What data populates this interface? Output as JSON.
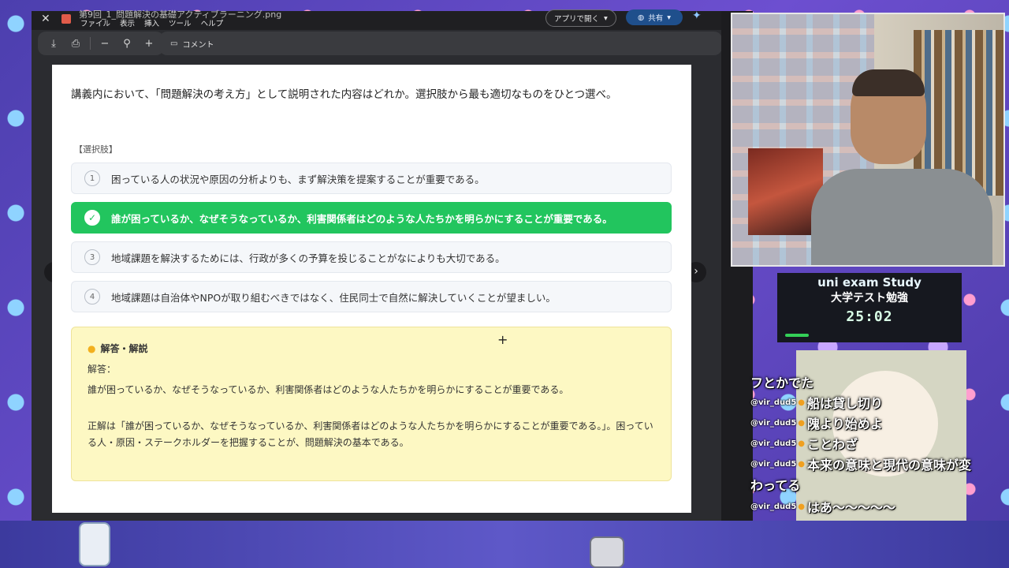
{
  "viewer": {
    "title": "第9回_1_問題解決の基礎アクティブラーニング.png",
    "menu": [
      "ファイル",
      "表示",
      "挿入",
      "ツール",
      "ヘルプ"
    ],
    "open_with_label": "アプリで開く",
    "share_label": "共有",
    "comment_label": "コメント"
  },
  "doc": {
    "question": "講義内において、「問題解決の考え方」として説明された内容はどれか。選択肢から最も適切なものをひとつ選べ。",
    "options_label": "【選択肢】",
    "options": [
      {
        "num": "1",
        "text": "困っている人の状況や原因の分析よりも、まず解決策を提案することが重要である。"
      },
      {
        "num": "✓",
        "text": "誰が困っているか、なぜそうなっているか、利害関係者はどのような人たちかを明らかにすることが重要である。"
      },
      {
        "num": "3",
        "text": "地域課題を解決するためには、行政が多くの予算を投じることがなによりも大切である。"
      },
      {
        "num": "4",
        "text": "地域課題は自治体やNPOが取り組むべきではなく、住民同士で自然に解決していくことが望ましい。"
      }
    ],
    "answer": {
      "title": "解答・解説",
      "label": "解答：",
      "text": "誰が困っているか、なぜそうなっているか、利害関係者はどのような人たちかを明らかにすることが重要である。",
      "explanation": "正解は「誰が困っているか、なぜそうなっているか、利害関係者はどのような人たちかを明らかにすることが重要である。」。困っている人・原因・ステークホルダーを把握することが、問題解決の基本である。"
    }
  },
  "timer": {
    "title": "uni exam Study",
    "subtitle": "大学テスト勉強",
    "value": "25:02"
  },
  "chat": [
    {
      "user": "",
      "message": "フとかでた"
    },
    {
      "user": "@vir_dud5",
      "message": "船は貸し切り"
    },
    {
      "user": "@vir_dud5",
      "message": "隗より始めよ"
    },
    {
      "user": "@vir_dud5",
      "message": "ことわざ"
    },
    {
      "user": "@vir_dud5",
      "message": "本来の意味と現代の意味が変"
    },
    {
      "user": "",
      "message": "わってる"
    },
    {
      "user": "@vir_dud5",
      "message": "はあ～～～～～"
    }
  ]
}
